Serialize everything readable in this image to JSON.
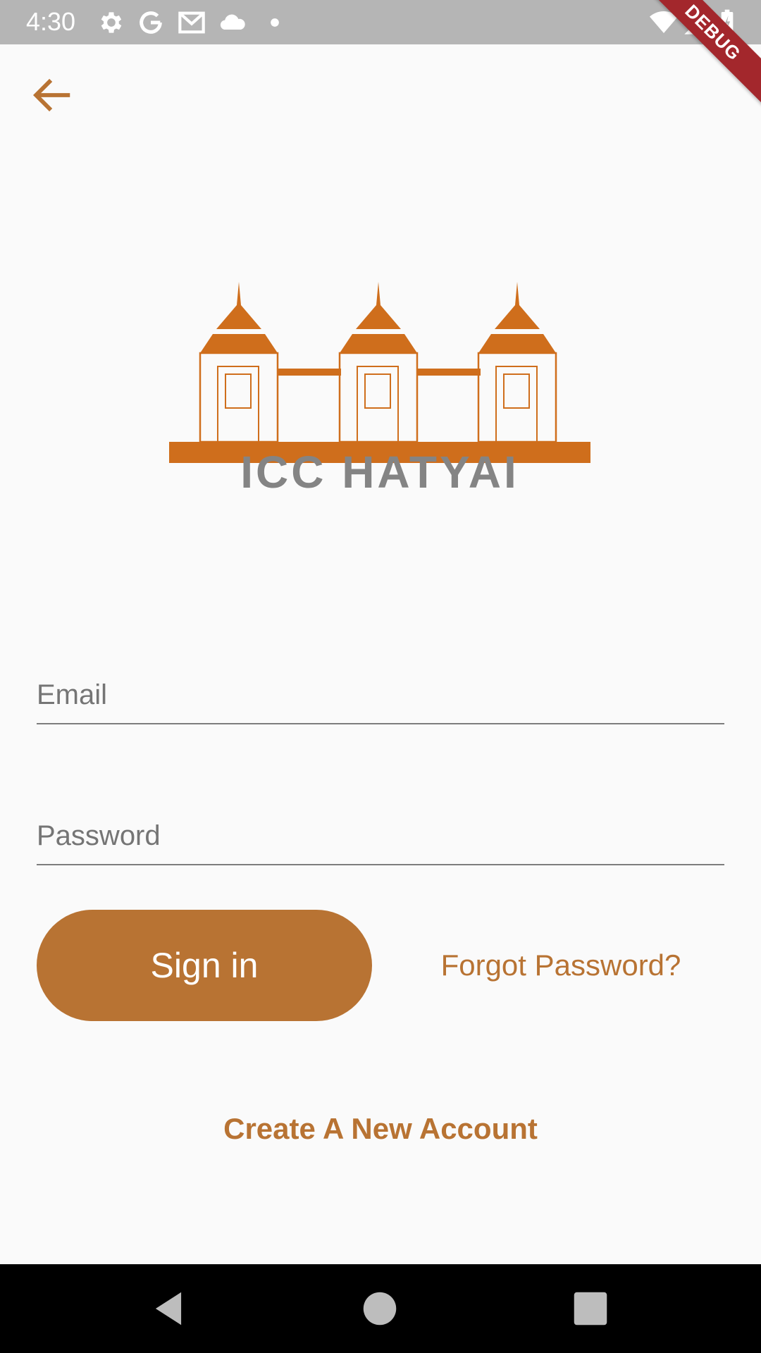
{
  "status_bar": {
    "time": "4:30",
    "icons": [
      "settings-icon",
      "google-icon",
      "gmail-icon",
      "cloud-icon",
      "dot-icon",
      "wifi-icon",
      "signal-icon",
      "battery-icon"
    ]
  },
  "debug_banner": "DEBUG",
  "app": {
    "back_icon": "arrow-back-icon",
    "logo_text": "ICC HATYAI",
    "accent_color": "#b87333",
    "logo_color": "#cf6e1c"
  },
  "form": {
    "email_placeholder": "Email",
    "password_placeholder": "Password",
    "sign_in_label": "Sign in",
    "forgot_password_label": "Forgot Password?",
    "create_account_label": "Create A New Account"
  },
  "nav_bar": {
    "icons": [
      "nav-back-icon",
      "nav-home-icon",
      "nav-recents-icon"
    ]
  }
}
